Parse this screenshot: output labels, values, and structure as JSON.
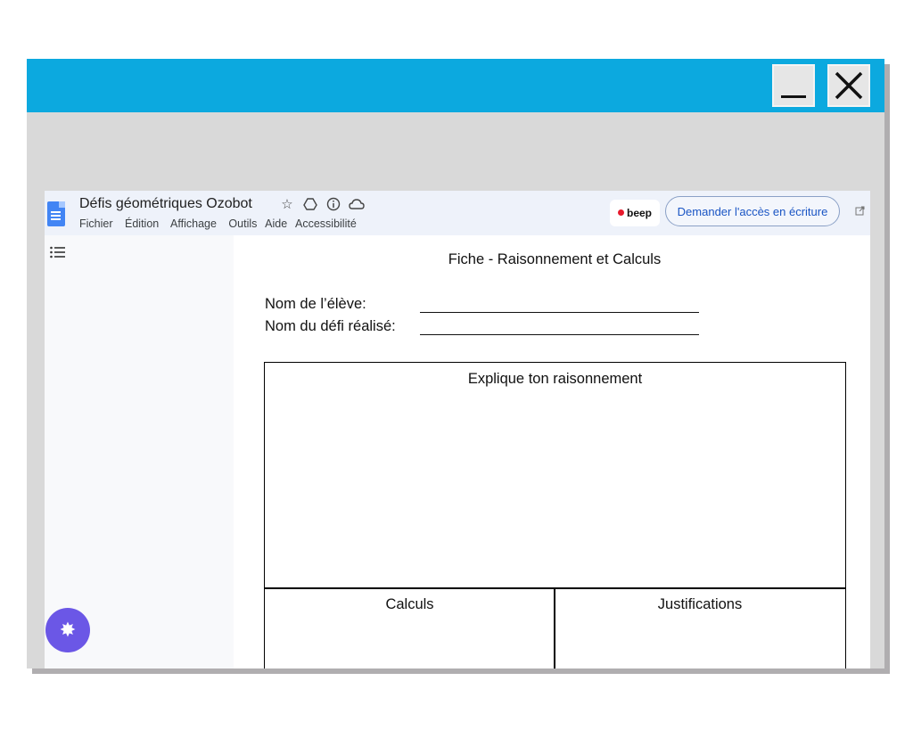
{
  "window": {
    "minimize_icon": "minimize-icon",
    "close_icon": "close-icon",
    "titlebar_color": "#0ca9df"
  },
  "doc": {
    "title": "Défis géométriques Ozobot",
    "title_icons": [
      "star-icon",
      "move-to-drive-icon",
      "info-icon",
      "cloud-status-icon"
    ],
    "menu": [
      "Fichier",
      "Édition",
      "Affichage",
      "Outils",
      "Aide",
      "Accessibilité"
    ],
    "beep_label": "beep",
    "request_access": "Demander l'accès en écriture",
    "accent_color": "#1a55c4"
  },
  "sheet": {
    "title": "Fiche - Raisonnement et Calculs",
    "student_name_label": "Nom de l’élève:",
    "challenge_label": "Nom du défi réalisé:",
    "reasoning_label": "Explique ton raisonnement",
    "calculations_label": "Calculs",
    "justifications_label": "Justifications"
  }
}
